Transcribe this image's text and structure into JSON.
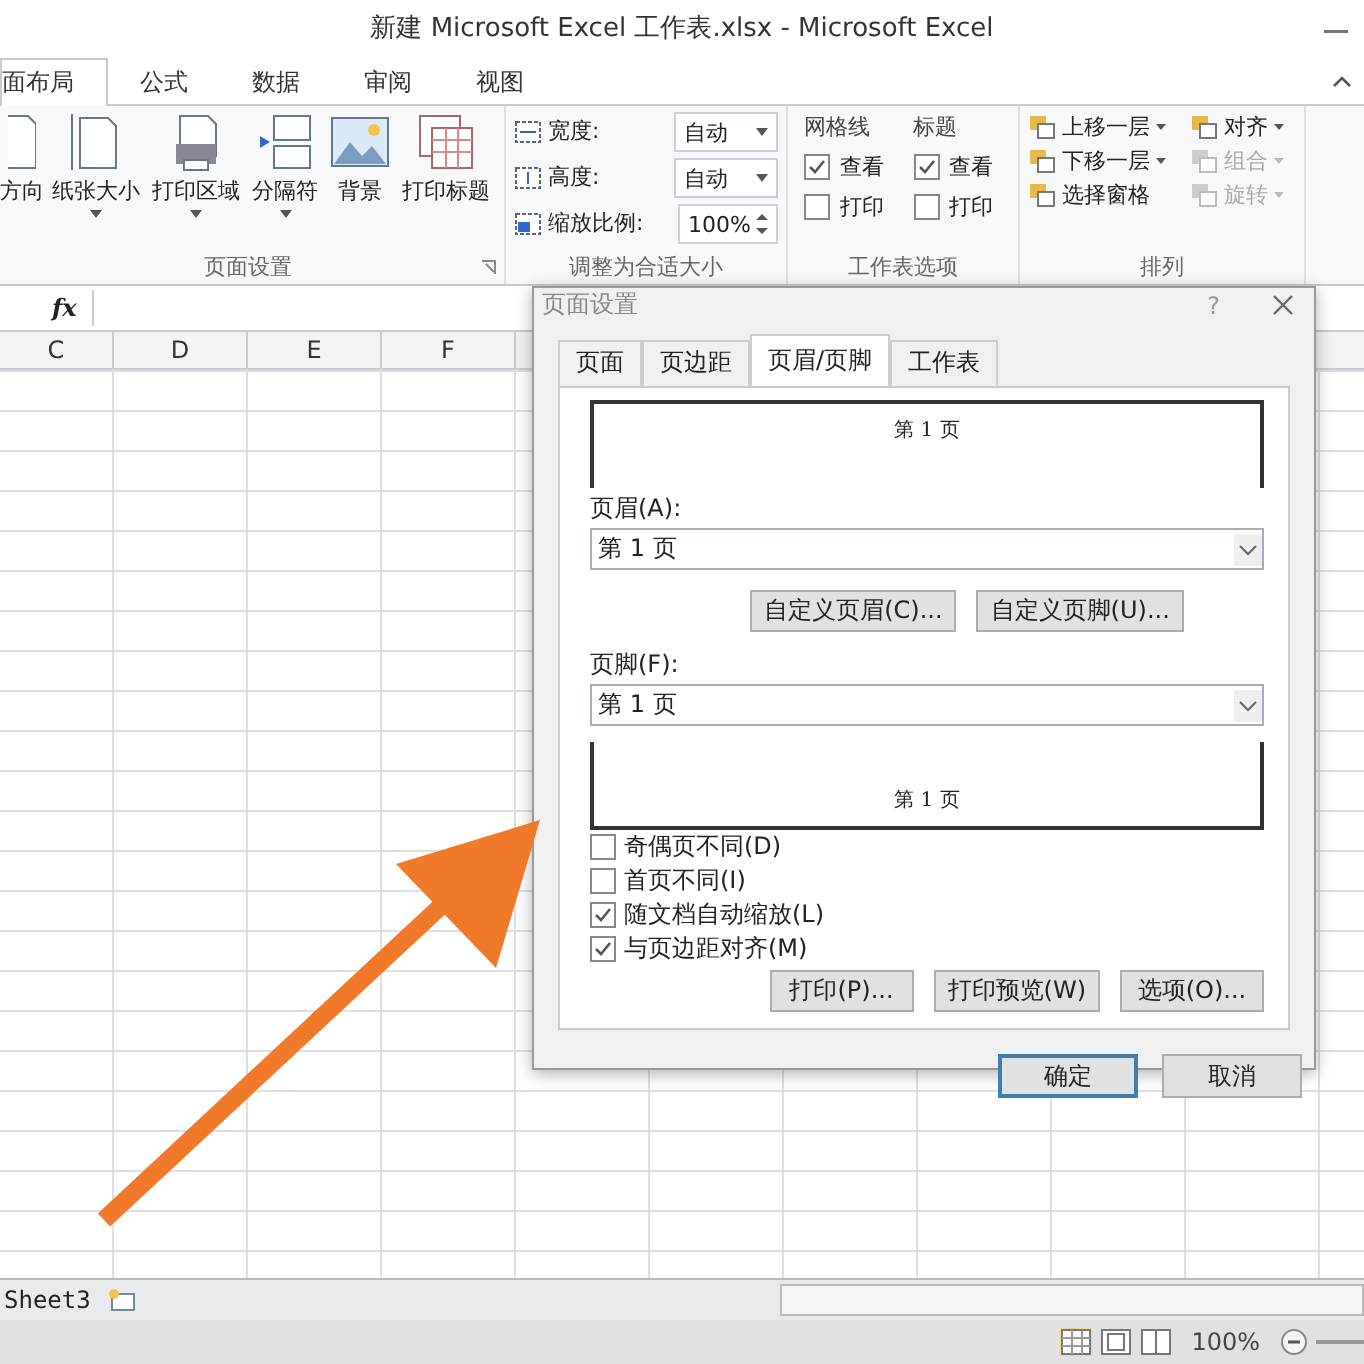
{
  "window": {
    "title": "新建 Microsoft Excel 工作表.xlsx - Microsoft Excel"
  },
  "ribbon_tabs": [
    {
      "label": "面布局",
      "selected": true
    },
    {
      "label": "公式",
      "selected": false
    },
    {
      "label": "数据",
      "selected": false
    },
    {
      "label": "审阅",
      "selected": false
    },
    {
      "label": "视图",
      "selected": false
    }
  ],
  "page_setup_group": {
    "label": "页面设置",
    "buttons": [
      {
        "kind": "orientation",
        "label": "方向",
        "dropdown": false
      },
      {
        "kind": "size",
        "label": "纸张大小",
        "dropdown": true
      },
      {
        "kind": "print_area",
        "label": "打印区域",
        "dropdown": true
      },
      {
        "kind": "breaks",
        "label": "分隔符",
        "dropdown": true
      },
      {
        "kind": "background",
        "label": "背景",
        "dropdown": false
      },
      {
        "kind": "titles",
        "label": "打印标题",
        "dropdown": false
      }
    ]
  },
  "scale_group": {
    "label": "调整为合适大小",
    "fields": [
      {
        "kind": "width",
        "label": "宽度:",
        "value": "自动"
      },
      {
        "kind": "height",
        "label": "高度:",
        "value": "自动"
      },
      {
        "kind": "scale",
        "label": "缩放比例:",
        "value": "100%"
      }
    ]
  },
  "sheet_options_group": {
    "label": "工作表选项",
    "columns": [
      {
        "title": "网格线",
        "items": [
          {
            "label": "查看",
            "checked": true
          },
          {
            "label": "打印",
            "checked": false
          }
        ]
      },
      {
        "title": "标题",
        "items": [
          {
            "label": "查看",
            "checked": true
          },
          {
            "label": "打印",
            "checked": false
          }
        ]
      }
    ]
  },
  "arrange_group": {
    "label": "排列",
    "items": [
      {
        "kind": "forward",
        "label": "上移一层",
        "disabled": false
      },
      {
        "kind": "align",
        "label": "对齐",
        "disabled": false
      },
      {
        "kind": "backward",
        "label": "下移一层",
        "disabled": false
      },
      {
        "kind": "group",
        "label": "组合",
        "disabled": true
      },
      {
        "kind": "pane",
        "label": "选择窗格",
        "disabled": false
      },
      {
        "kind": "rotate",
        "label": "旋转",
        "disabled": true
      }
    ]
  },
  "formula_bar": {
    "fx": "fx"
  },
  "columns": [
    "C",
    "D",
    "E",
    "F"
  ],
  "dialog": {
    "title": "页面设置",
    "help": "?",
    "tabs": [
      {
        "label": "页面",
        "selected": false
      },
      {
        "label": "页边距",
        "selected": false
      },
      {
        "label": "页眉/页脚",
        "selected": true
      },
      {
        "label": "工作表",
        "selected": false
      }
    ],
    "header_preview": "第 1 页",
    "header_label": "页眉(A):",
    "header_value": "第 1 页",
    "custom_buttons": [
      "自定义页眉(C)...",
      "自定义页脚(U)..."
    ],
    "footer_label": "页脚(F):",
    "footer_value": "第 1 页",
    "footer_preview": "第 1 页",
    "checkboxes": [
      {
        "label": "奇偶页不同(D)",
        "checked": false
      },
      {
        "label": "首页不同(I)",
        "checked": false
      },
      {
        "label": "随文档自动缩放(L)",
        "checked": true
      },
      {
        "label": "与页边距对齐(M)",
        "checked": true
      }
    ],
    "action_buttons": [
      "打印(P)...",
      "打印预览(W)",
      "选项(O)..."
    ],
    "ok": "确定",
    "cancel": "取消"
  },
  "sheet_tabs": [
    "Sheet3"
  ],
  "status_bar": {
    "zoom": "100%"
  }
}
